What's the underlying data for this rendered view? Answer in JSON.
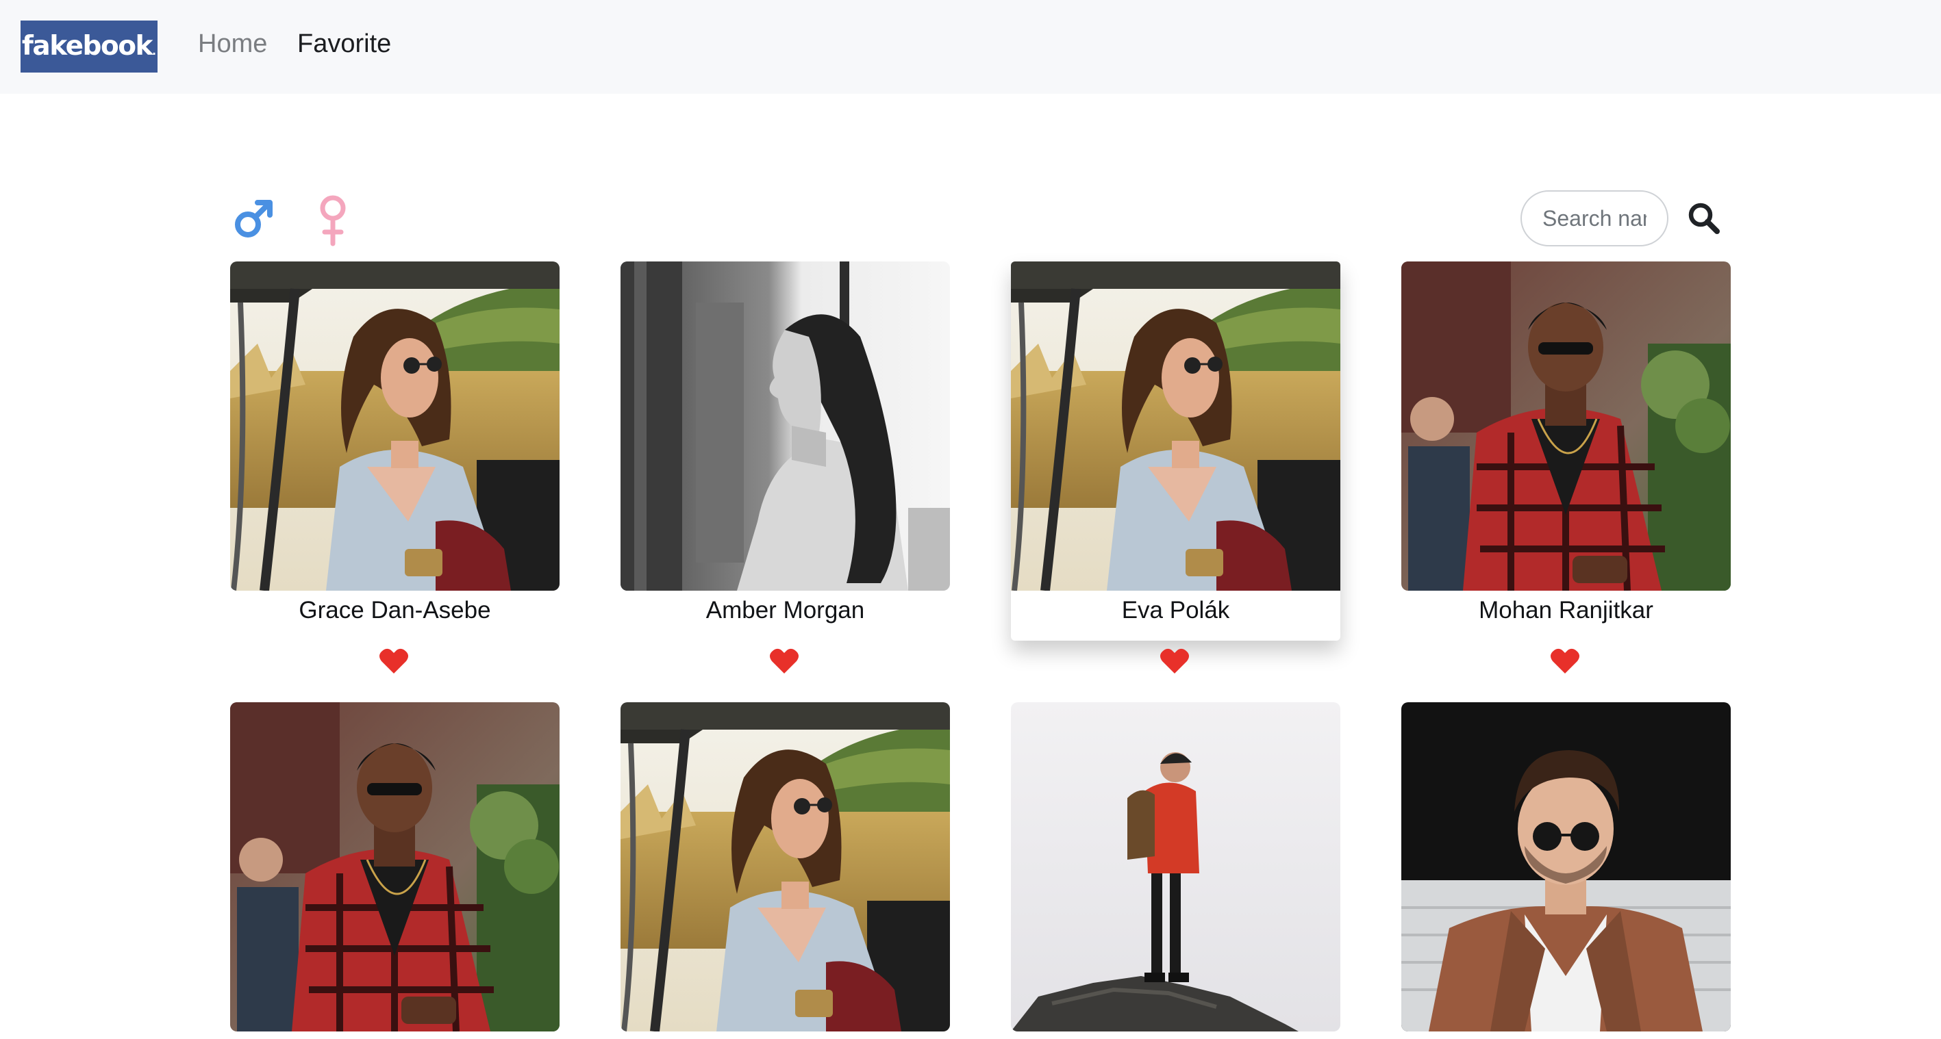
{
  "navbar": {
    "brand": "fakebook",
    "links": [
      {
        "label": "Home",
        "active": false
      },
      {
        "label": "Favorite",
        "active": true
      }
    ]
  },
  "filters": {
    "male_icon": "male-symbol-icon",
    "female_icon": "female-symbol-icon",
    "male_color": "#4a90e2",
    "female_color": "#f4a6bd"
  },
  "search": {
    "placeholder": "Search name",
    "value": "",
    "button_icon": "search-icon"
  },
  "colors": {
    "brand": "#3b5998",
    "navbar_bg": "#f7f8fa",
    "heart": "#e8302a"
  },
  "cards": [
    {
      "name": "Grace Dan-Asebe",
      "photo": "woman-sunglasses-cart-photo",
      "favorited": true
    },
    {
      "name": "Amber Morgan",
      "photo": "woman-profile-bw-photo",
      "favorited": true
    },
    {
      "name": "Eva Polák",
      "photo": "woman-sunglasses-cart-photo",
      "favorited": true
    },
    {
      "name": "Mohan Ranjitkar",
      "photo": "man-plaid-shirt-photo",
      "favorited": true
    },
    {
      "name": "",
      "photo": "man-plaid-shirt-photo",
      "favorited": null
    },
    {
      "name": "",
      "photo": "woman-sunglasses-cart-photo",
      "favorited": null
    },
    {
      "name": "",
      "photo": "hiker-on-rock-photo",
      "favorited": null
    },
    {
      "name": "",
      "photo": "man-brown-jacket-photo",
      "favorited": null
    }
  ]
}
